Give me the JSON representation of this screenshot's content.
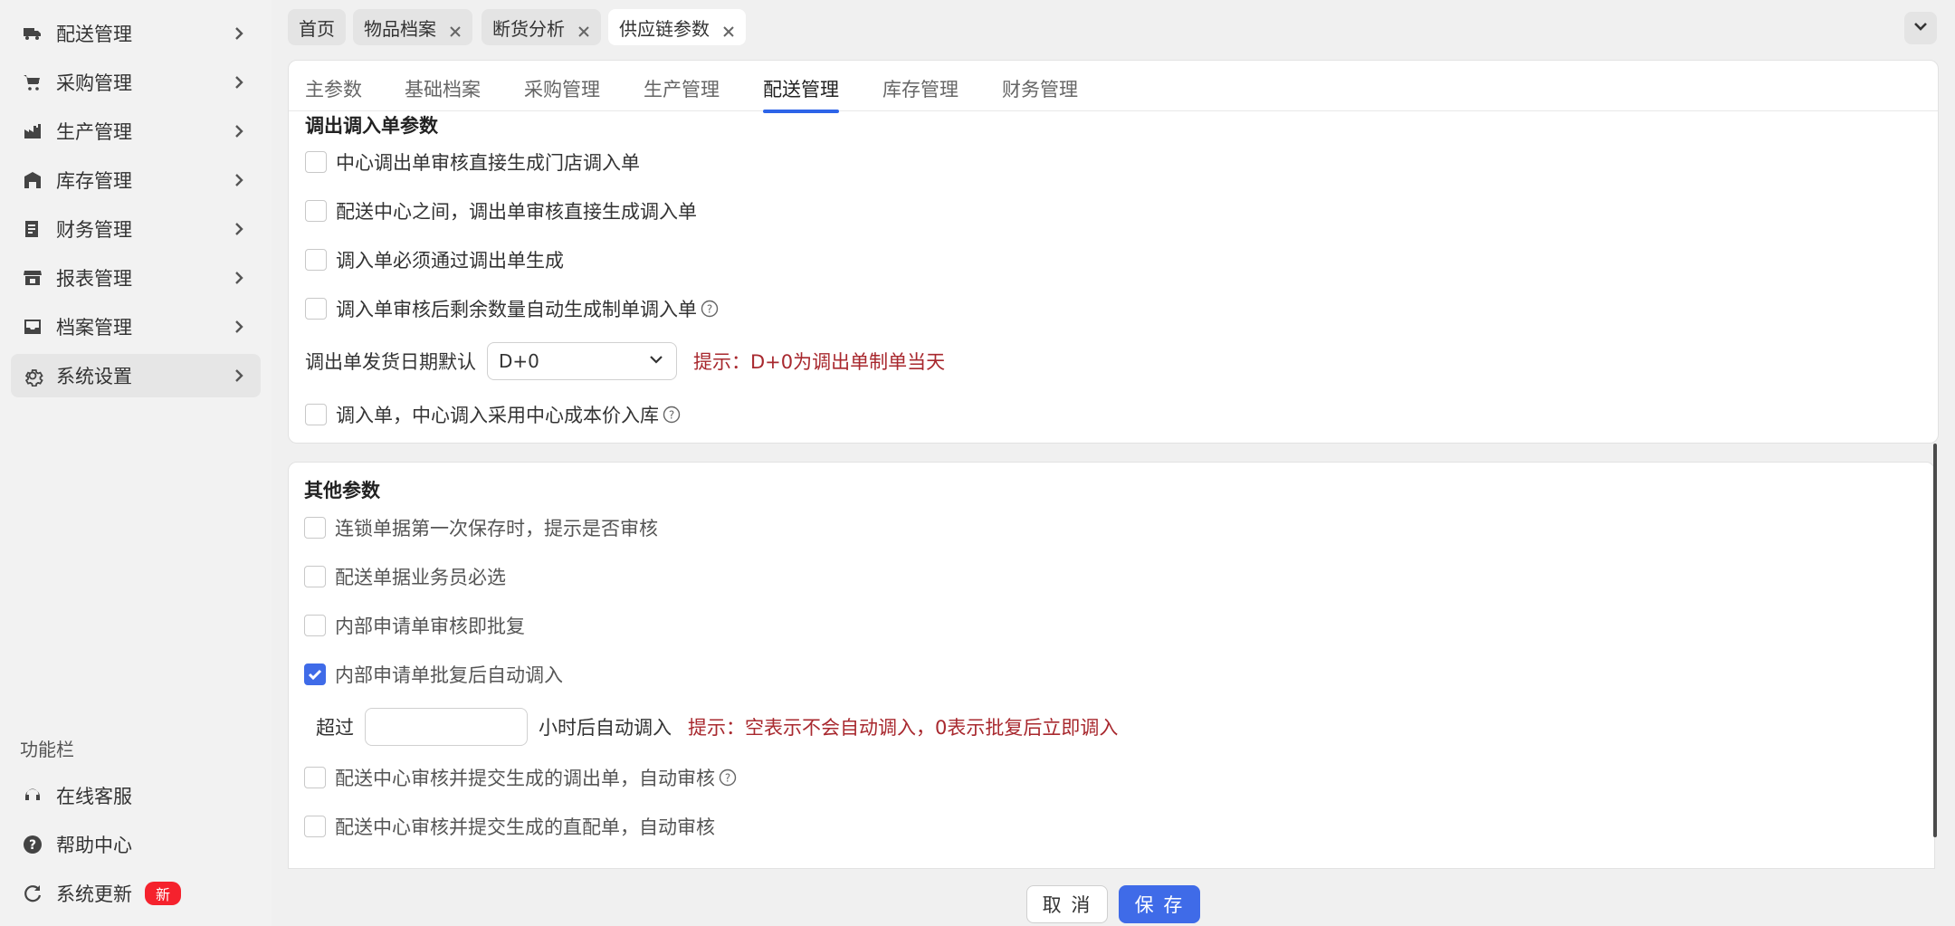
{
  "sidebar": {
    "items": [
      {
        "label": "配送管理",
        "icon": "truck-icon"
      },
      {
        "label": "采购管理",
        "icon": "cart-icon"
      },
      {
        "label": "生产管理",
        "icon": "factory-icon"
      },
      {
        "label": "库存管理",
        "icon": "warehouse-icon"
      },
      {
        "label": "财务管理",
        "icon": "finance-icon"
      },
      {
        "label": "报表管理",
        "icon": "store-icon"
      },
      {
        "label": "档案管理",
        "icon": "inbox-icon"
      },
      {
        "label": "系统设置",
        "icon": "gear-icon"
      }
    ],
    "function_title": "功能栏",
    "functions": [
      {
        "label": "在线客服",
        "icon": "headset-icon"
      },
      {
        "label": "帮助中心",
        "icon": "help-circle-icon"
      },
      {
        "label": "系统更新",
        "icon": "refresh-icon",
        "badge": "新"
      }
    ]
  },
  "top_tabs": [
    {
      "label": "首页",
      "closable": false
    },
    {
      "label": "物品档案",
      "closable": true
    },
    {
      "label": "断货分析",
      "closable": true
    },
    {
      "label": "供应链参数",
      "closable": true,
      "active": true
    }
  ],
  "sub_tabs": [
    "主参数",
    "基础档案",
    "采购管理",
    "生产管理",
    "配送管理",
    "库存管理",
    "财务管理"
  ],
  "active_sub_tab": "配送管理",
  "transfer_section": {
    "title": "调出调入单参数",
    "options": [
      {
        "label": "中心调出单审核直接生成门店调入单",
        "checked": false
      },
      {
        "label": "配送中心之间，调出单审核直接生成调入单",
        "checked": false
      },
      {
        "label": "调入单必须通过调出单生成",
        "checked": false
      },
      {
        "label": "调入单审核后剩余数量自动生成制单调入单",
        "checked": false,
        "help": true
      }
    ],
    "date_label": "调出单发货日期默认",
    "date_value": "D+0",
    "date_hint": "提示：D+0为调出单制单当天",
    "last_option": {
      "label": "调入单，中心调入采用中心成本价入库",
      "checked": false,
      "help": true
    }
  },
  "other_section": {
    "title": "其他参数",
    "options": [
      {
        "label": "连锁单据第一次保存时，提示是否审核",
        "checked": false
      },
      {
        "label": "配送单据业务员必选",
        "checked": false
      },
      {
        "label": "内部申请单审核即批复",
        "checked": false
      },
      {
        "label": "内部申请单批复后自动调入",
        "checked": true
      }
    ],
    "hours_prefix": "超过",
    "hours_value": "",
    "hours_suffix": "小时后自动调入",
    "hours_hint": "提示：空表示不会自动调入，0表示批复后立即调入",
    "options2": [
      {
        "label": "配送中心审核并提交生成的调出单，自动审核",
        "checked": false,
        "help": true
      },
      {
        "label": "配送中心审核并提交生成的直配单，自动审核",
        "checked": false
      }
    ]
  },
  "footer": {
    "cancel_label": "取 消",
    "save_label": "保 存"
  },
  "colors": {
    "accent": "#3f6be8",
    "hint": "#a8282e",
    "badge": "#f5222d"
  }
}
